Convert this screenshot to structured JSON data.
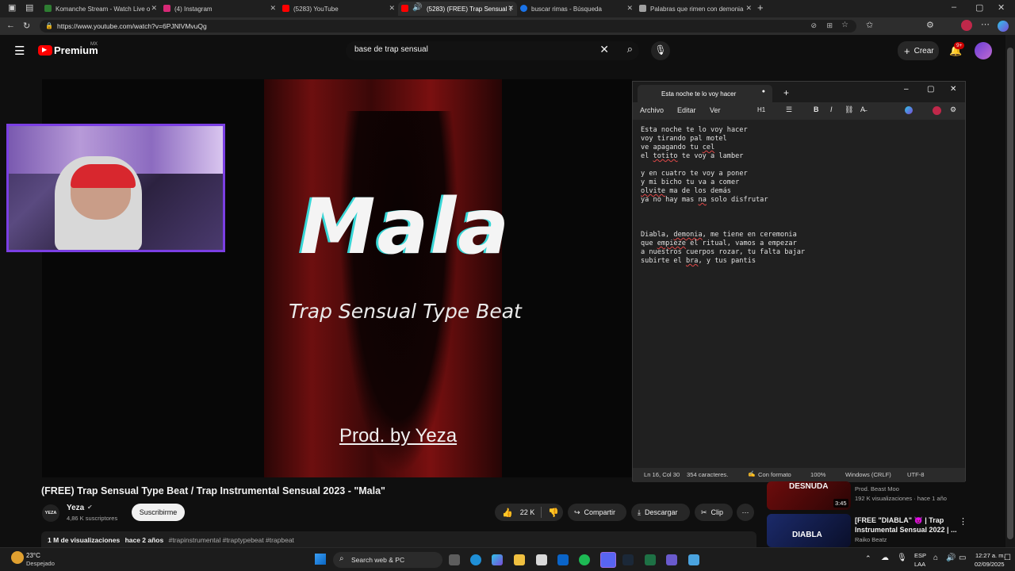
{
  "browser": {
    "tabs": [
      {
        "title": "Komanche Stream - Watch Live o",
        "color": "#2e7d32"
      },
      {
        "title": "(4) Instagram",
        "color": "#d62976"
      },
      {
        "title": "(5283) YouTube",
        "color": "#ff0000"
      },
      {
        "title": "(5283) (FREE) Trap Sensual T",
        "color": "#ff0000"
      },
      {
        "title": "buscar rimas - Búsqueda",
        "color": "#1a73e8"
      },
      {
        "title": "Palabras que rimen con demonia",
        "color": "#a0a0a0"
      }
    ],
    "new_tab_glyph": "+",
    "url": "https://www.youtube.com/watch?v=6PJNlVMvuQg"
  },
  "youtube": {
    "logo": "Premium",
    "region": "MX",
    "search_value": "base de trap sensual",
    "create_label": "Crear",
    "notification_count": "9+"
  },
  "video": {
    "overlay_title": "Mala",
    "overlay_subtitle": "Trap Sensual Type Beat",
    "overlay_credit": "Prod. by Yeza",
    "title": "(FREE) Trap Sensual Type Beat / Trap Instrumental Sensual 2023 - \"Mala\"",
    "channel": "Yeza",
    "channel_avatar": "YEZA",
    "subscribers": "4,86 K suscriptores",
    "subscribe_label": "Suscribirme",
    "likes": "22 K",
    "share_label": "Compartir",
    "download_label": "Descargar",
    "clip_label": "Clip",
    "views": "1 M de visualizaciones",
    "age": "hace 2 años",
    "hashtags": "#trapinstrumental #traptypebeat #trapbeat"
  },
  "notepad": {
    "tab_title": "Esta noche te lo voy hacer",
    "menu": [
      "Archivo",
      "Editar",
      "Ver"
    ],
    "heading_label": "H1",
    "lines": [
      "Esta noche te lo voy hacer",
      "voy tirando pal motel",
      "ve apagando tu cel",
      "el totito te voy a lamber",
      "",
      "y en cuatro te voy a poner",
      "y mi bicho tu va a comer",
      "olvite ma de los demás",
      "ya no hay mas na solo disfrutar",
      "",
      "",
      "",
      "Diabla, demonia, me tiene en ceremonia",
      "que empieze el ritual, vamos a empezar",
      "a nuestros cuerpos rozar, tu falta bajar",
      "subirte el bra, y tus pantis"
    ],
    "status": {
      "position": "Ln 16, Col 30",
      "chars": "354 caracteres.",
      "format": "Con formato",
      "zoom": "100%",
      "eol": "Windows (CRLF)",
      "encoding": "UTF-8"
    }
  },
  "sidebar": {
    "items": [
      {
        "thumb_text": "DESNUDA",
        "duration": "3:45",
        "channel": "Prod. Beast Moo",
        "meta": "192 K visualizaciones · hace 1 año"
      },
      {
        "thumb_text": "DIABLA",
        "title_line1": "[FREE \"DIABLA\" 😈 | Trap",
        "title_line2": "Instrumental Sensual 2022 | ...",
        "channel": "Raiko Beatz"
      }
    ]
  },
  "taskbar": {
    "weather_temp": "23°C",
    "weather_desc": "Despejado",
    "search_label": "Search web & PC",
    "lang_top": "ESP",
    "lang_bottom": "LAA",
    "time": "12:27 a. m.",
    "date": "02/09/2025"
  }
}
